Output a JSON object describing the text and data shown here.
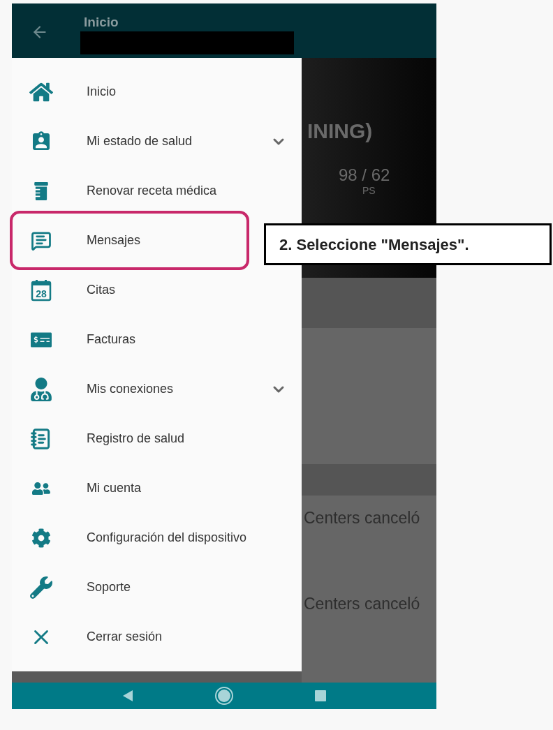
{
  "header": {
    "title": "Inicio"
  },
  "menu": [
    {
      "label": "Inicio",
      "highlighted": false
    },
    {
      "label": "Mi estado de salud",
      "highlighted": false,
      "expanded": false
    },
    {
      "label": "Renovar receta médica",
      "highlighted": false
    },
    {
      "label": "Mensajes",
      "highlighted": true
    },
    {
      "label": "Citas",
      "highlighted": false,
      "icon_text": "28"
    },
    {
      "label": "Facturas",
      "highlighted": false
    },
    {
      "label": "Mis conexiones",
      "highlighted": false,
      "expanded": false
    },
    {
      "label": "Registro de salud",
      "highlighted": false
    },
    {
      "label": "Mi cuenta",
      "highlighted": false
    },
    {
      "label": "Configuración del dispositivo",
      "highlighted": false
    },
    {
      "label": "Soporte",
      "highlighted": false
    },
    {
      "label": "Cerrar sesión",
      "highlighted": false
    }
  ],
  "background": {
    "heading": "INING)",
    "reading": "98 / 62",
    "reading_unit": "PS",
    "notices": [
      "Centers canceló",
      "Centers canceló"
    ]
  },
  "callout": "2. Seleccione \"Mensajes\"."
}
